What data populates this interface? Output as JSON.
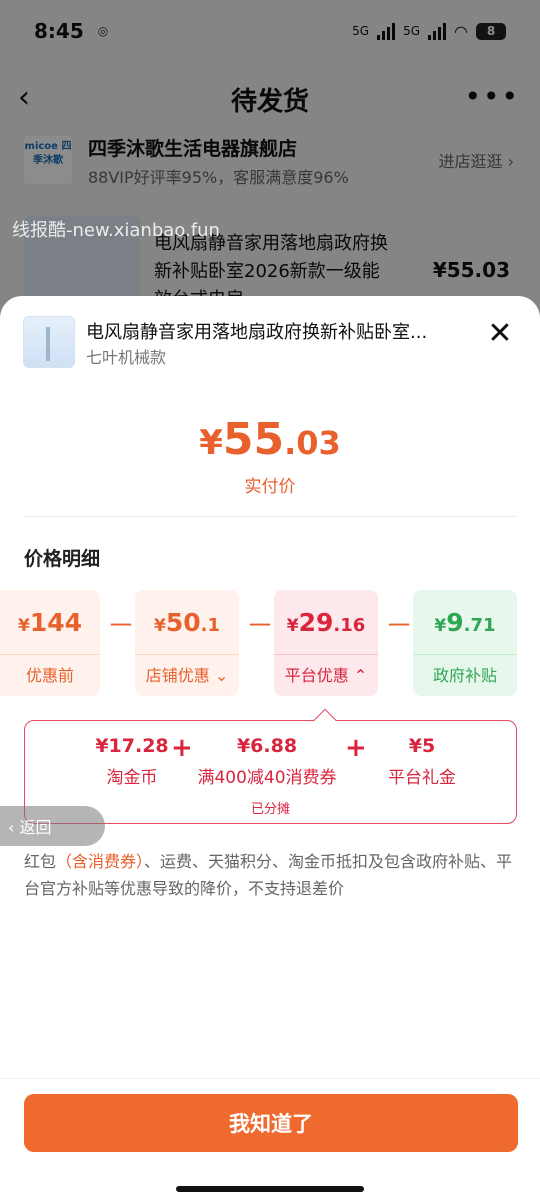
{
  "status": {
    "time": "8:45",
    "net1": "5G",
    "net2": "5G",
    "battery": "8"
  },
  "nav": {
    "back": "‹",
    "title": "待发货",
    "more": "•••"
  },
  "store": {
    "logo_text": "micoe 四季沐歌",
    "name": "四季沐歌生活电器旗舰店",
    "subtitle": "88VIP好评率95%，客服满意度96%",
    "link": "进店逛逛 ›"
  },
  "watermark": "线报酷-new.xianbao.fun",
  "bg_product": {
    "title": "电风扇静音家用落地扇政府换新补贴卧室2026新款一级能效台式电扇",
    "price": "¥55.03"
  },
  "sheet": {
    "title": "电风扇静音家用落地扇政府换新补贴卧室...",
    "sku": "七叶机械款",
    "close": "✕",
    "price_currency": "¥",
    "price_int": "55",
    "price_dec": ".03",
    "price_label": "实付价",
    "section_title": "价格明细",
    "cards": [
      {
        "cur": "¥",
        "int": "144",
        "dec": "",
        "label": "优惠前"
      },
      {
        "cur": "¥",
        "int": "50",
        "dec": ".1",
        "label": "店铺优惠 ⌄"
      },
      {
        "cur": "¥",
        "int": "29",
        "dec": ".16",
        "label": "平台优惠 ⌃"
      },
      {
        "cur": "¥",
        "int": "9",
        "dec": ".71",
        "label": "政府补贴"
      }
    ],
    "minus": "－",
    "detail": {
      "items": [
        {
          "value": "¥17.28",
          "name": "淘金币"
        },
        {
          "value": "¥6.88",
          "name": "满400减40消费券"
        },
        {
          "value": "¥5",
          "name": "平台礼金"
        }
      ],
      "plus": "+",
      "split_note": "已分摊"
    },
    "note_prefix": "红包",
    "note_highlight": "（含消费券）",
    "note_rest": "、运费、天猫积分、淘金币抵扣及包含政府补贴、平台官方补贴等优惠导致的降价，不支持退差价",
    "back_pill": "‹ 返回",
    "ok_button": "我知道了"
  },
  "colors": {
    "accent": "#ef6a2e",
    "platform_red": "#d8263f",
    "gov_green": "#2fa653"
  }
}
